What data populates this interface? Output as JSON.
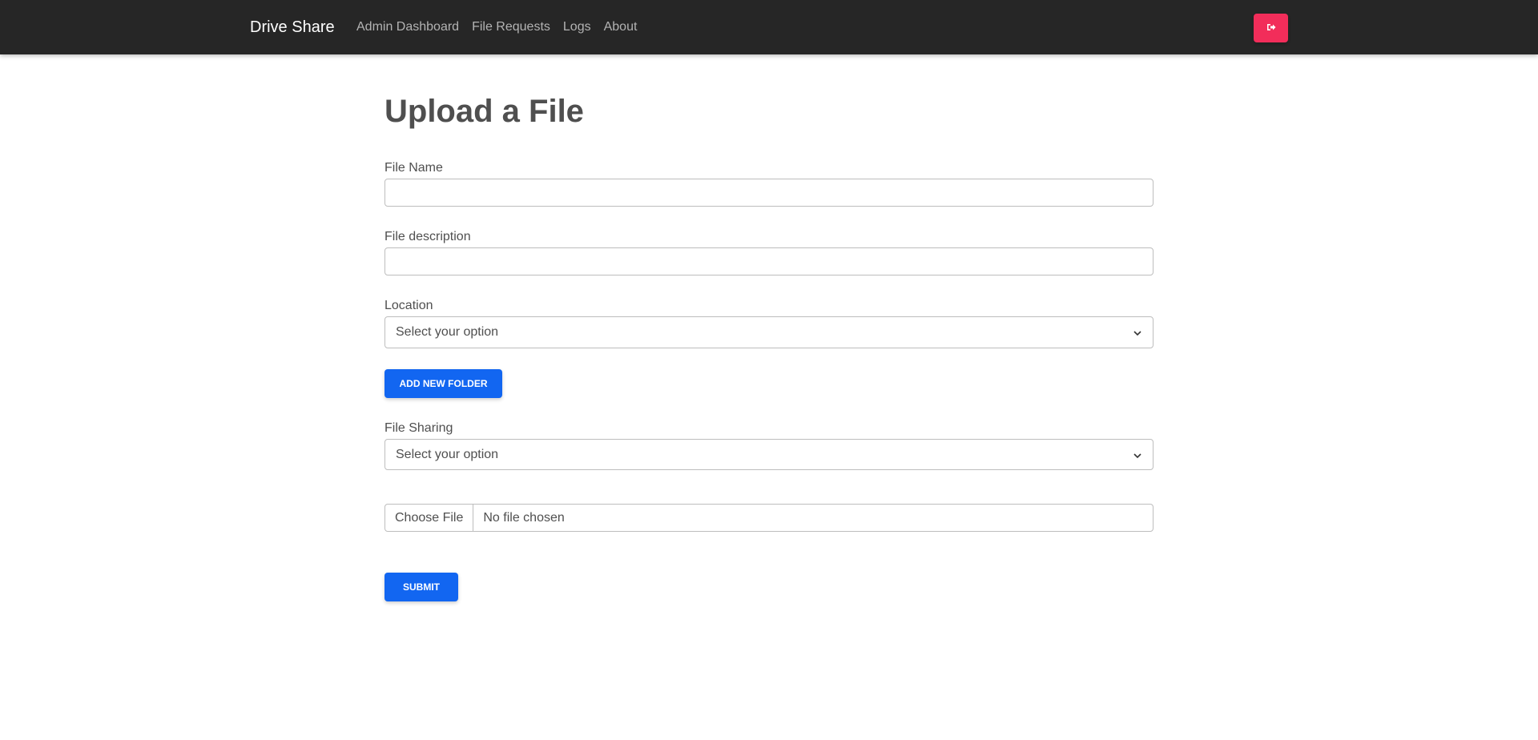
{
  "navbar": {
    "brand": "Drive Share",
    "links": [
      "Admin Dashboard",
      "File Requests",
      "Logs",
      "About"
    ],
    "logout_icon": "sign-out-icon",
    "accent_color": "#f22d5a"
  },
  "form": {
    "title": "Upload a File",
    "file_name": {
      "label": "File Name",
      "value": ""
    },
    "file_description": {
      "label": "File description",
      "value": ""
    },
    "location": {
      "label": "Location",
      "selected": "Select your option"
    },
    "add_folder_label": "ADD NEW FOLDER",
    "file_sharing": {
      "label": "File Sharing",
      "selected": "Select your option"
    },
    "file_input": {
      "button_label": "Choose File",
      "status": "No file chosen"
    },
    "submit_label": "SUBMIT",
    "primary_color": "#1266f1"
  }
}
